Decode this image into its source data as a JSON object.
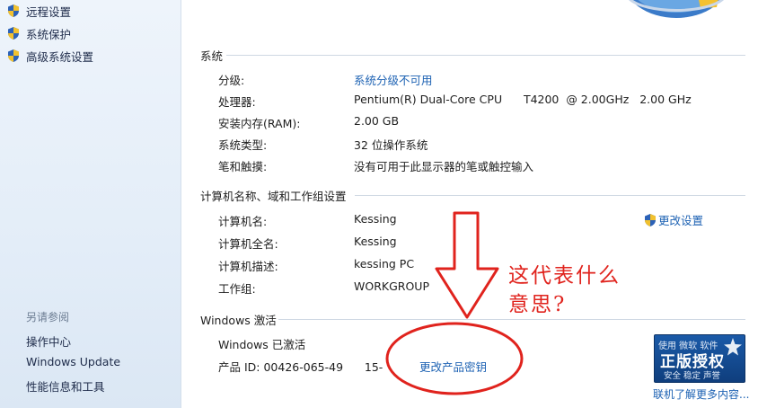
{
  "sidebar": {
    "top_items": [
      {
        "label": "远程设置"
      },
      {
        "label": "系统保护"
      },
      {
        "label": "高级系统设置"
      }
    ],
    "see_also_title": "另请参阅",
    "links": [
      {
        "label": "操作中心"
      },
      {
        "label": "Windows Update"
      },
      {
        "label": "性能信息和工具"
      }
    ]
  },
  "system": {
    "title": "系统",
    "rows": [
      {
        "label": "分级:",
        "value": "系统分级不可用"
      },
      {
        "label": "处理器:",
        "value": "Pentium(R) Dual-Core CPU      T4200  @ 2.00GHz   2.00 GHz"
      },
      {
        "label": "安装内存(RAM):",
        "value": "2.00 GB"
      },
      {
        "label": "系统类型:",
        "value": "32 位操作系统"
      },
      {
        "label": "笔和触摸:",
        "value": "没有可用于此显示器的笔或触控输入"
      }
    ]
  },
  "computer": {
    "title": "计算机名称、域和工作组设置",
    "change_settings": "更改设置",
    "rows": [
      {
        "label": "计算机名:",
        "value": "Kessing"
      },
      {
        "label": "计算机全名:",
        "value": "Kessing"
      },
      {
        "label": "计算机描述:",
        "value": "kessing PC"
      },
      {
        "label": "工作组:",
        "value": "WORKGROUP"
      }
    ]
  },
  "activation": {
    "title": "Windows 激活",
    "status": "Windows 已激活",
    "product_id": "产品 ID: 00426-065-49      15-",
    "change_key": "更改产品密钥",
    "learn_more": "联机了解更多内容...",
    "badge": {
      "top": "使用 微软 软件",
      "main": "正版授权",
      "sub": "安全 稳定 声誉"
    }
  },
  "annotation": {
    "line1": "这代表什么",
    "line2": "意思?",
    "color": "#e0231d"
  },
  "colors": {
    "link": "#1d62b3",
    "sidebar_bg": "#e3edf8"
  }
}
